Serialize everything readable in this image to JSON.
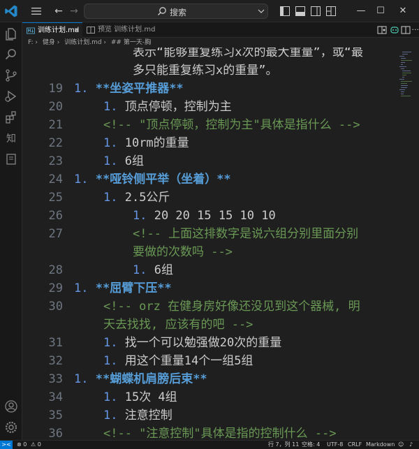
{
  "titlebar": {
    "search_label": "搜索",
    "back_label": "←",
    "forward_label": "→",
    "minimize_label": "—",
    "maximize_label": "☐",
    "close_label": "✕"
  },
  "activitybar": {
    "zhi_label": "知"
  },
  "tabs": [
    {
      "label": "训练计划.md",
      "active": true,
      "close": "×"
    },
    {
      "label": "预览 训练计划.md",
      "active": false
    }
  ],
  "breadcrumb": {
    "drive": "F: ›",
    "folder": "健身 ›",
    "file": "训练计划.md ›",
    "section": "## 第一天-胸"
  },
  "editor": {
    "lines": [
      {
        "num": "",
        "indent": 4,
        "parts": [
          {
            "t": "表示“能够重复练习x次的最大重量”，或“最",
            "c": "tx"
          }
        ]
      },
      {
        "num": "",
        "indent": 4,
        "parts": [
          {
            "t": "多只能重复练习x的重量”。",
            "c": "tx"
          }
        ]
      },
      {
        "num": "19",
        "indent": 0,
        "parts": [
          {
            "t": "1. ",
            "c": "mk"
          },
          {
            "t": "**坐姿平推器**",
            "c": "hd"
          }
        ]
      },
      {
        "num": "20",
        "indent": 2,
        "parts": [
          {
            "t": "1. ",
            "c": "mk"
          },
          {
            "t": "顶点停顿，控制为主",
            "c": "tx"
          }
        ]
      },
      {
        "num": "21",
        "indent": 2,
        "parts": [
          {
            "t": "<!-- \"顶点停顿，控制为主\"具体是指什么 -->",
            "c": "cm"
          }
        ]
      },
      {
        "num": "22",
        "indent": 2,
        "parts": [
          {
            "t": "1. ",
            "c": "mk"
          },
          {
            "t": "10rm的重量",
            "c": "tx"
          }
        ]
      },
      {
        "num": "23",
        "indent": 2,
        "parts": [
          {
            "t": "1. ",
            "c": "mk"
          },
          {
            "t": "6组",
            "c": "tx"
          }
        ]
      },
      {
        "num": "24",
        "indent": 0,
        "parts": [
          {
            "t": "1. ",
            "c": "mk"
          },
          {
            "t": "**哑铃侧平举（坐着）**",
            "c": "hd"
          }
        ]
      },
      {
        "num": "25",
        "indent": 2,
        "parts": [
          {
            "t": "1. ",
            "c": "mk"
          },
          {
            "t": "2.5公斤",
            "c": "tx"
          }
        ]
      },
      {
        "num": "26",
        "indent": 4,
        "parts": [
          {
            "t": "1. ",
            "c": "mk"
          },
          {
            "t": "20 20 15 15 10 10",
            "c": "tx"
          }
        ]
      },
      {
        "num": "27",
        "indent": 4,
        "parts": [
          {
            "t": "<!-- 上面这排数字是说六组分别里面分别",
            "c": "cm"
          }
        ]
      },
      {
        "num": "",
        "indent": 4,
        "parts": [
          {
            "t": "要做的次数吗 -->",
            "c": "cm"
          }
        ]
      },
      {
        "num": "28",
        "indent": 4,
        "parts": [
          {
            "t": "1. ",
            "c": "mk"
          },
          {
            "t": "6组",
            "c": "tx"
          }
        ]
      },
      {
        "num": "29",
        "indent": 0,
        "parts": [
          {
            "t": "1. ",
            "c": "mk"
          },
          {
            "t": "**屈臂下压**",
            "c": "hd"
          }
        ]
      },
      {
        "num": "30",
        "indent": 2,
        "parts": [
          {
            "t": "<!-- orz 在健身房好像还没见到这个器械, 明",
            "c": "cm"
          }
        ]
      },
      {
        "num": "",
        "indent": 2,
        "parts": [
          {
            "t": "天去找找, 应该有的吧 -->",
            "c": "cm"
          }
        ]
      },
      {
        "num": "31",
        "indent": 2,
        "parts": [
          {
            "t": "1. ",
            "c": "mk"
          },
          {
            "t": "找一个可以勉强做20次的重量",
            "c": "tx"
          }
        ]
      },
      {
        "num": "32",
        "indent": 2,
        "parts": [
          {
            "t": "1. ",
            "c": "mk"
          },
          {
            "t": "用这个重量14个一组5组",
            "c": "tx"
          }
        ]
      },
      {
        "num": "33",
        "indent": 0,
        "parts": [
          {
            "t": "1. ",
            "c": "mk"
          },
          {
            "t": "**蝴蝶机肩膀后束**",
            "c": "hd"
          }
        ]
      },
      {
        "num": "34",
        "indent": 2,
        "parts": [
          {
            "t": "1. ",
            "c": "mk"
          },
          {
            "t": "15次 4组",
            "c": "tx"
          }
        ]
      },
      {
        "num": "35",
        "indent": 2,
        "parts": [
          {
            "t": "1. ",
            "c": "mk"
          },
          {
            "t": "注意控制",
            "c": "tx"
          }
        ]
      },
      {
        "num": "36",
        "indent": 2,
        "parts": [
          {
            "t": "<!-- \"注意控制\"具体是指的控制什么 -->",
            "c": "cm"
          }
        ]
      }
    ]
  },
  "statusbar": {
    "remote": "><",
    "errors": "⊗ 0",
    "warnings": "⚠ 0",
    "position": "行 7，列 11",
    "spaces": "空格: 4",
    "encoding": "UTF-8",
    "eol": "CRLF",
    "language": "Markdown",
    "notify": "🔔"
  },
  "colors": {
    "accent": "#0078d4",
    "marker": "#6796e6",
    "heading": "#569cd6",
    "comment": "#6a9955"
  }
}
